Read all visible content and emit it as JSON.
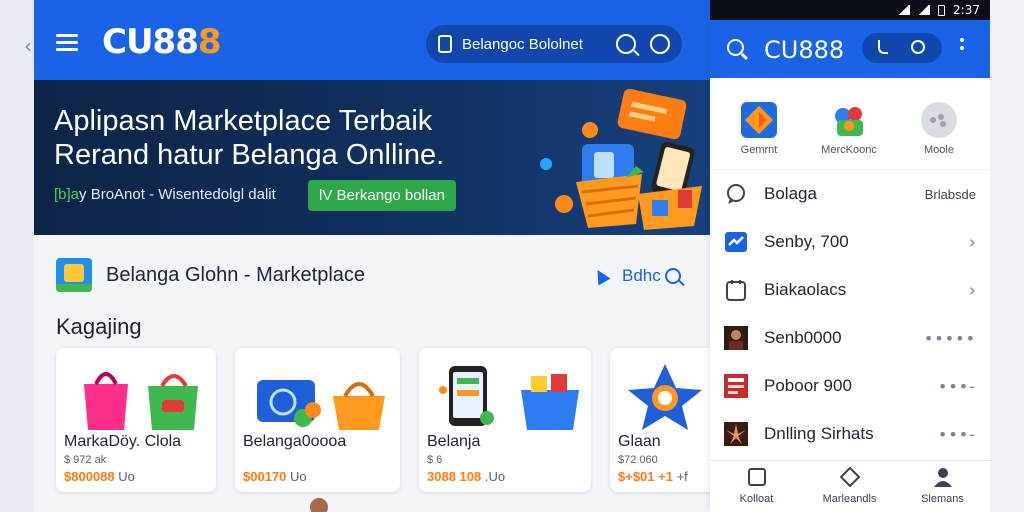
{
  "colors": {
    "brand_blue": "#1a63e6",
    "accent_orange": "#ff9a1f",
    "cta_green": "#2fa84a",
    "hero_navy": "#0c2447"
  },
  "header": {
    "logo_main": "CU88",
    "logo_accent": "8",
    "search_text": "Belangoc Bololnet"
  },
  "hero": {
    "title_line1": "Aplipasn Marketplace Terbaik",
    "title_line2": "Rerand hatur Belanga Onlline.",
    "sub_mark": "[b]a",
    "sub_text": "y BroAnot - Wisentedolgl dalit",
    "cta": "lV Berkango bollan"
  },
  "section": {
    "title": "Belanga Glohn - Marketplace",
    "link": "Bdhc"
  },
  "categories_title": "Kagajing",
  "products": [
    {
      "name": "MarkaDöy. Clola",
      "meta": "$ 972 ak",
      "price": "$800088",
      "rest": " Uo"
    },
    {
      "name": "Belanga0oooa",
      "meta": "",
      "price": "$00170",
      "rest": " Uo"
    },
    {
      "name": "Belanja",
      "meta": "$ 6",
      "price": "3088 108",
      "rest": " .Uo"
    },
    {
      "name": "Glaan",
      "meta": "$72 060",
      "price": "$+$01 +1",
      "rest": " +f"
    }
  ],
  "phone": {
    "status_time": "2:37",
    "logo": "CU888",
    "categories": [
      {
        "icon": "star-tile-icon",
        "label": "Gemrnt"
      },
      {
        "icon": "shopping-tile-icon",
        "label": "MercKoonc"
      },
      {
        "icon": "profile-circle-icon",
        "label": "Moole"
      }
    ],
    "rows": [
      {
        "icon": "chat-bubble-icon",
        "label": "Bolaga",
        "right": "Brlabsde",
        "trail": ""
      },
      {
        "icon": "chart-box-icon",
        "label": "Senby, 700",
        "right": "",
        "trail": "›"
      },
      {
        "icon": "calendar-icon",
        "label": "Biakaolacs",
        "right": "",
        "trail": "›"
      },
      {
        "icon": "person-thumb-icon",
        "label": "Senb0000",
        "right": "",
        "trail": "•••••"
      },
      {
        "icon": "book-thumb-icon",
        "label": "Poboor 900",
        "right": "",
        "trail": "•••-"
      },
      {
        "icon": "film-thumb-icon",
        "label": "Dnlling Sirhats",
        "right": "",
        "trail": "•••-"
      }
    ],
    "tabs": [
      {
        "icon": "home-square-icon",
        "label": "Kolloat"
      },
      {
        "icon": "tag-diamond-icon",
        "label": "Marleandls"
      },
      {
        "icon": "profile-icon",
        "label": "Slemans"
      }
    ]
  }
}
